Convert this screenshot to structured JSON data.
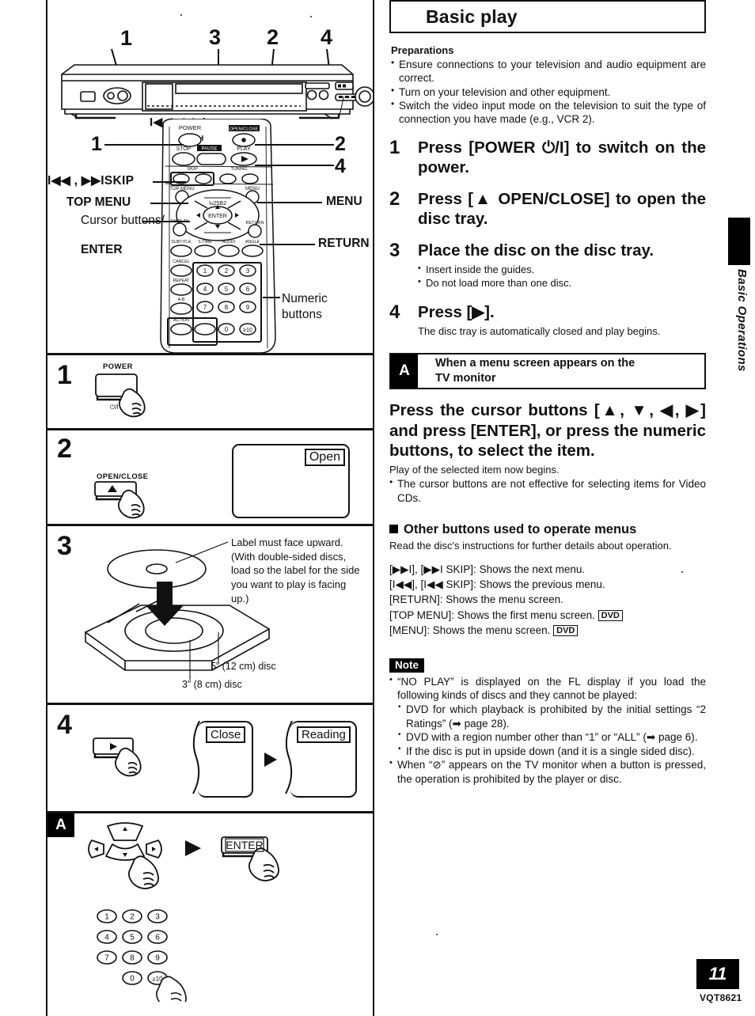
{
  "header": {
    "title": "Basic play"
  },
  "side_tab": {
    "label": "Basic Operations"
  },
  "footer": {
    "page_number": "11",
    "doc_code": "VQT8621"
  },
  "preparations": {
    "heading": "Preparations",
    "bullets": [
      "Ensure connections to your television and audio equipment are correct.",
      "Turn on your television and other equipment.",
      "Switch the video input mode on the television to suit the type of connection you have made (e.g., VCR 2)."
    ]
  },
  "steps": [
    {
      "number": "1",
      "text": "Press [POWER ⏻/I] to switch on the power.",
      "subs": []
    },
    {
      "number": "2",
      "text": "Press [▲ OPEN/CLOSE] to open the disc tray.",
      "subs": []
    },
    {
      "number": "3",
      "text": "Place the disc on the disc tray.",
      "subs": [
        {
          "type": "bullet",
          "text": "Insert inside the guides."
        },
        {
          "type": "bullet",
          "text": "Do not load more than one disc."
        }
      ]
    },
    {
      "number": "4",
      "text": "Press [▶].",
      "subs": [
        {
          "type": "plain",
          "text": "The disc tray is automatically closed and play begins."
        }
      ]
    }
  ],
  "section_a": {
    "badge": "A",
    "title_line1": "When a menu screen appears on the",
    "title_line2": "TV monitor",
    "instruction": "Press the cursor buttons [▲, ▼, ◀, ▶] and press [ENTER], or press the numeric buttons, to select the item.",
    "note_plain": "Play of the selected item now begins.",
    "note_bullet": "The cursor buttons are not effective for selecting items for Video CDs."
  },
  "other_buttons": {
    "heading": "Other buttons used to operate menus",
    "intro": "Read the disc's instructions for further details about operation.",
    "rows": [
      {
        "keys": "[▶▶I], [▶▶I SKIP]:",
        "desc": "Shows the next menu.",
        "chip": ""
      },
      {
        "keys": "[I◀◀], [I◀◀ SKIP]:",
        "desc": "Shows the previous menu.",
        "chip": ""
      },
      {
        "keys": "[RETURN]:",
        "desc": "Shows the menu screen.",
        "chip": ""
      },
      {
        "keys": "[TOP MENU]:",
        "desc": "Shows the first menu screen.",
        "chip": "DVD"
      },
      {
        "keys": "[MENU]:",
        "desc": "Shows the menu screen.",
        "chip": "DVD"
      }
    ]
  },
  "note": {
    "chip": "Note",
    "items": [
      {
        "level": 1,
        "text": "“NO PLAY” is displayed on the FL display if you load the following kinds of discs and they cannot be played:"
      },
      {
        "level": 2,
        "text": "DVD for which playback is prohibited by the initial settings “2 Ratings” (➡ page 28)."
      },
      {
        "level": 2,
        "text": "DVD with a region number other than “1” or “ALL” (➡ page 6)."
      },
      {
        "level": 2,
        "text": "If the disc is put in upside down (and it is a single sided disc)."
      },
      {
        "level": 1,
        "text": "When “⊘” appears on the TV monitor when a button is pressed, the operation is prohibited by the player or disc."
      }
    ]
  },
  "diagrams": {
    "device": {
      "callouts": [
        "1",
        "3",
        "2",
        "4"
      ],
      "skip_label": "I◀◀ ,  ▶▶I"
    },
    "remote": {
      "callout_1": "1",
      "callout_2": "2",
      "callout_4": "4",
      "left_labels": [
        "I◀◀ ,  ▶▶ISKIP",
        "TOP MENU",
        "Cursor buttons/",
        "ENTER"
      ],
      "right_labels": [
        "MENU",
        "RETURN",
        "Numeric buttons"
      ],
      "keys": {
        "power": "POWER",
        "open_close": "OPEN/CLOSE",
        "stop": "STOP",
        "pause": "PAUSE",
        "play": "PLAY",
        "skip": "SKIP",
        "tuning": "TUNING",
        "slow_search": "SLOW/SEARCH",
        "top_menu": "TOP MENU",
        "menu": "MENU",
        "enter": "ENTER",
        "display": "DISPLAY",
        "return": "RETURN",
        "subtitle": "SUBTITLE",
        "s_time": "S.TIME",
        "audio": "AUDIO",
        "angle": "ANGLE",
        "cancel": "CANCEL",
        "repeat": "REPEAT",
        "a_b": "A-B",
        "action": "ACTION"
      },
      "numeric": [
        "1",
        "2",
        "3",
        "4",
        "5",
        "6",
        "7",
        "8",
        "9",
        "0",
        "≥10"
      ]
    },
    "step1": {
      "num": "1",
      "key_top": "POWER",
      "key_bottom": "⏻/I"
    },
    "step2": {
      "num": "2",
      "key_label": "OPEN/CLOSE",
      "key_glyph": "▲",
      "osd_text": "Open"
    },
    "step3": {
      "num": "3",
      "callout": "Label must face upward. (With double-sided discs, load so the label for the side you want to play is facing up.)",
      "label_12cm": "5” (12 cm) disc",
      "label_8cm": "3” (8 cm) disc"
    },
    "step4": {
      "num": "4",
      "key_glyph": "▶",
      "osd_1": "Close",
      "osd_2": "Reading"
    },
    "step_a": {
      "badge": "A",
      "enter_label": "ENTER",
      "numeric": [
        "1",
        "2",
        "3",
        "4",
        "5",
        "6",
        "7",
        "8",
        "9",
        "0",
        "≥10"
      ]
    }
  }
}
